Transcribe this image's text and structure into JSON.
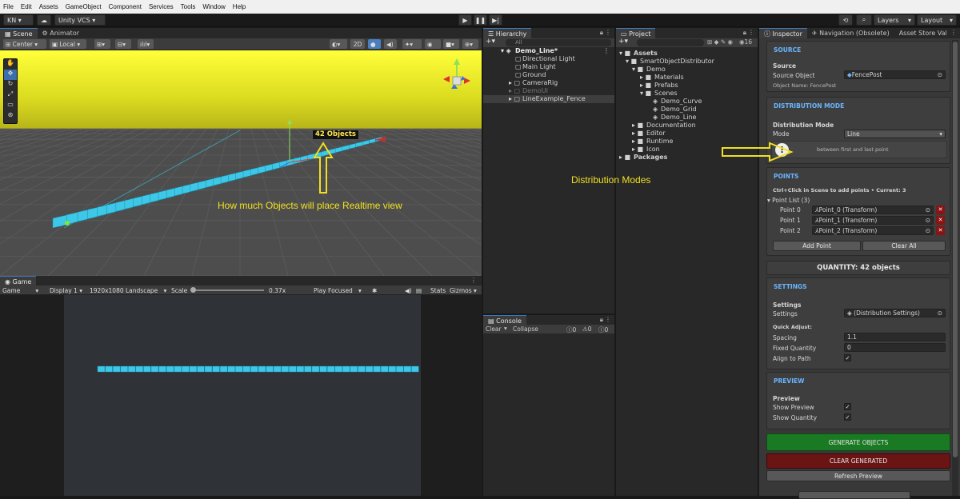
{
  "menu": [
    "File",
    "Edit",
    "Assets",
    "GameObject",
    "Component",
    "Services",
    "Tools",
    "Window",
    "Help"
  ],
  "toolbar": {
    "account": "KN ▾",
    "vcs": "Unity VCS ▾",
    "layers": "Layers",
    "layout": "Layout"
  },
  "scene": {
    "tabs": [
      "Scene",
      "Animator"
    ],
    "pivot": "Center",
    "space": "Local",
    "mode_2d": "2D",
    "objects_label": "42 Objects",
    "annotation": "How much Objects will place Realtime view"
  },
  "game": {
    "tab": "Game",
    "display_mode": "Game",
    "display": "Display 1",
    "resolution": "1920x1080 Landscape",
    "scale_label": "Scale",
    "scale_value": "0.37x",
    "play_mode": "Play Focused",
    "stats": "Stats",
    "gizmos": "Gizmos"
  },
  "hierarchy": {
    "tab": "Hierarchy",
    "search_placeholder": "All",
    "scene": "Demo_Line*",
    "items": [
      "Directional Light",
      "Main Light",
      "Ground",
      "CameraRig",
      "DemoUI",
      "LineExample_Fence"
    ]
  },
  "console": {
    "tab": "Console",
    "clear": "Clear",
    "collapse": "Collapse",
    "count_log": "0",
    "count_warn": "0",
    "count_err": "0"
  },
  "project": {
    "tab": "Project",
    "hidden_count": "16",
    "assets": "Assets",
    "smart": "SmartObjectDistributor",
    "demo": "Demo",
    "materials": "Materials",
    "prefabs": "Prefabs",
    "scenes": "Scenes",
    "scene_files": [
      "Demo_Curve",
      "Demo_Grid",
      "Demo_Line"
    ],
    "documentation": "Documentation",
    "editor": "Editor",
    "runtime": "Runtime",
    "icon": "Icon",
    "packages": "Packages"
  },
  "center_annotation": "Distribution Modes",
  "inspector": {
    "tabs": [
      "Inspector",
      "Navigation (Obsolete)",
      "Asset Store Val"
    ],
    "source": {
      "header": "SOURCE",
      "sub": "Source",
      "label": "Source Object",
      "value": "FencePost",
      "name_line": "Object Name: FencePost"
    },
    "distribution": {
      "header": "DISTRIBUTION MODE",
      "sub": "Distribution Mode",
      "mode_label": "Mode",
      "mode_value": "Line",
      "info": "between first and last point"
    },
    "points": {
      "header": "POINTS",
      "hint": "Ctrl+Click in Scene to add points • Current: 3",
      "list_label": "Point List (3)",
      "items": [
        {
          "label": "Point 0",
          "value": "Point_0 (Transform)"
        },
        {
          "label": "Point 1",
          "value": "Point_1 (Transform)"
        },
        {
          "label": "Point 2",
          "value": "Point_2 (Transform)"
        }
      ],
      "add": "Add Point",
      "clear": "Clear All"
    },
    "quantity": "QUANTITY: 42 objects",
    "settings": {
      "header": "SETTINGS",
      "sub": "Settings",
      "settings_label": "Settings",
      "settings_value": "(Distribution Settings)",
      "quick": "Quick Adjust:",
      "spacing_label": "Spacing",
      "spacing_value": "1.1",
      "fixed_label": "Fixed Quantity",
      "fixed_value": "0",
      "align_label": "Align to Path"
    },
    "preview": {
      "header": "PREVIEW",
      "sub": "Preview",
      "show_preview": "Show Preview",
      "show_quantity": "Show Quantity"
    },
    "generate": "GENERATE OBJECTS",
    "clear_generated": "CLEAR GENERATED",
    "refresh": "Refresh Preview",
    "colors": {
      "accent": "#6ab6ff",
      "generate": "#1a7a24",
      "clear": "#6a1414"
    }
  },
  "annotation_color": "#f0e020"
}
